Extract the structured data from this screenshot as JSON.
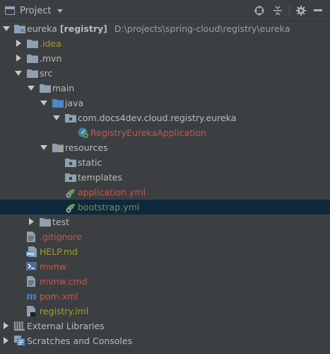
{
  "toolbar": {
    "title": "Project",
    "icons": [
      "target-icon",
      "collapse-icon",
      "gear-icon",
      "hide-icon"
    ]
  },
  "tree": {
    "root": {
      "name": "eureka",
      "module": "[registry]",
      "path": "D:\\projects\\spring-cloud\\registry\\eureka"
    },
    "items": [
      {
        "label": "eureka",
        "depth": 0,
        "state": "expanded",
        "icon": "module-folder-icon",
        "color": "default"
      },
      {
        "label": ".idea",
        "depth": 1,
        "state": "collapsed",
        "icon": "folder-icon",
        "color": "olive"
      },
      {
        "label": ".mvn",
        "depth": 1,
        "state": "collapsed",
        "icon": "folder-icon",
        "color": "default"
      },
      {
        "label": "src",
        "depth": 1,
        "state": "expanded",
        "icon": "folder-icon",
        "color": "default"
      },
      {
        "label": "main",
        "depth": 2,
        "state": "expanded",
        "icon": "folder-icon",
        "color": "default"
      },
      {
        "label": "java",
        "depth": 3,
        "state": "expanded",
        "icon": "source-folder-icon",
        "color": "default"
      },
      {
        "label": "com.docs4dev.cloud.registry.eureka",
        "depth": 4,
        "state": "expanded",
        "icon": "package-icon",
        "color": "default"
      },
      {
        "label": "RegistryEurekaApplication",
        "depth": 5,
        "state": "leaf",
        "icon": "spring-boot-class-icon",
        "color": "red"
      },
      {
        "label": "resources",
        "depth": 3,
        "state": "expanded",
        "icon": "resources-folder-icon",
        "color": "default"
      },
      {
        "label": "static",
        "depth": 4,
        "state": "leaf",
        "icon": "package-icon",
        "color": "default"
      },
      {
        "label": "templates",
        "depth": 4,
        "state": "leaf",
        "icon": "package-icon",
        "color": "default"
      },
      {
        "label": "application.yml",
        "depth": 4,
        "state": "leaf",
        "icon": "spring-yml-icon",
        "color": "red"
      },
      {
        "label": "bootstrap.yml",
        "depth": 4,
        "state": "leaf",
        "icon": "spring-yml-icon",
        "color": "green",
        "selected": true
      },
      {
        "label": "test",
        "depth": 2,
        "state": "collapsed",
        "icon": "folder-icon",
        "color": "default"
      },
      {
        "label": ".gitignore",
        "depth": 1,
        "state": "leaf",
        "icon": "text-file-icon",
        "color": "red"
      },
      {
        "label": "HELP.md",
        "depth": 1,
        "state": "leaf",
        "icon": "markdown-file-icon",
        "color": "olive"
      },
      {
        "label": "mvnw",
        "depth": 1,
        "state": "leaf",
        "icon": "shell-script-icon",
        "color": "red"
      },
      {
        "label": "mvnw.cmd",
        "depth": 1,
        "state": "leaf",
        "icon": "text-file-icon",
        "color": "red"
      },
      {
        "label": "pom.xml",
        "depth": 1,
        "state": "leaf",
        "icon": "maven-icon",
        "color": "red"
      },
      {
        "label": "registry.iml",
        "depth": 1,
        "state": "leaf",
        "icon": "iml-file-icon",
        "color": "olive"
      },
      {
        "label": "External Libraries",
        "depth": 0,
        "state": "collapsed",
        "icon": "libraries-icon",
        "color": "default"
      },
      {
        "label": "Scratches and Consoles",
        "depth": 0,
        "state": "collapsed",
        "icon": "scratches-icon",
        "color": "default"
      }
    ]
  },
  "colors": {
    "background": "#3c3f41",
    "selection": "#0d293e",
    "text": "#bbbbbb",
    "olive": "#a39d2b",
    "red": "#c7554b",
    "green": "#6b9a4f",
    "folder": "#8ea0b1",
    "source_folder": "#4a88c7"
  }
}
